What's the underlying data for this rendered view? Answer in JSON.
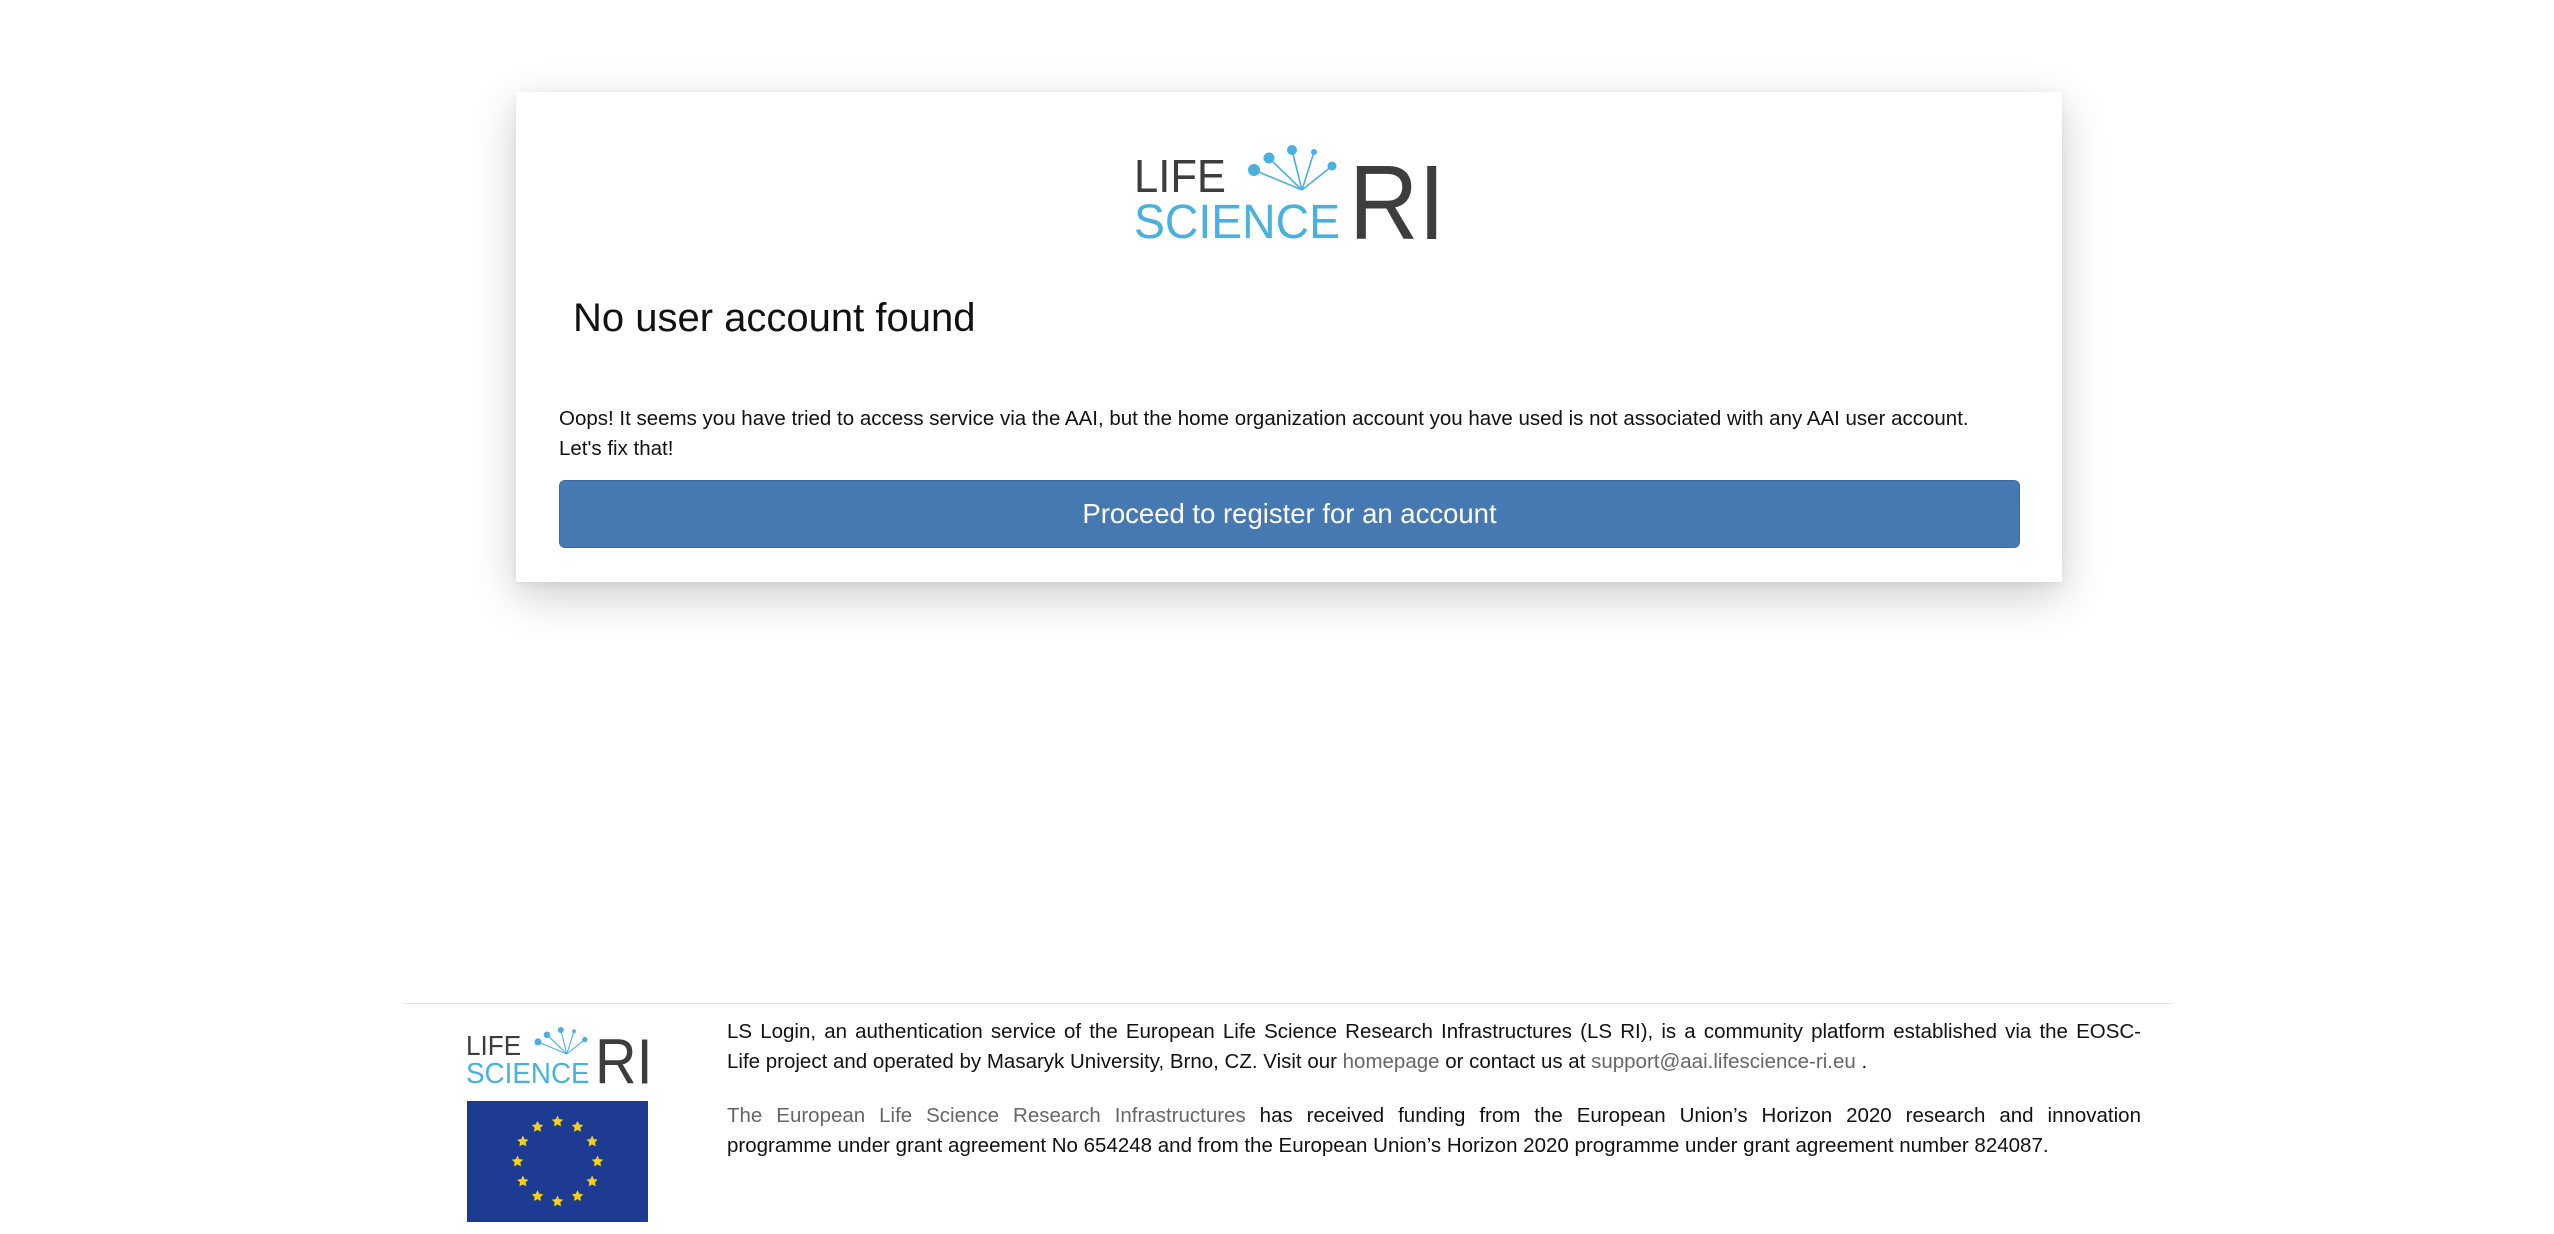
{
  "brand": {
    "logo_word_1": "LIFE",
    "logo_word_2": "SCIENCE",
    "logo_word_3": "RI",
    "dark_color": "#3d3d3d",
    "accent_color": "#4ab0e0"
  },
  "card": {
    "title": "No user account found",
    "message_line_1": "Oops! It seems you have tried to access service via the AAI, but the home organization account you have used is not associated with any AAI user account.",
    "message_line_2": "Let's fix that!",
    "register_button_label": "Proceed to register for an account",
    "button_color": "#4679b2"
  },
  "footer": {
    "para1_line1": "LS Login, an authentication service of the European Life Science Research Infrastructures (LS RI), is a community platform established via the EOSC-",
    "para1_line2_before": "Life project and operated by Masaryk University, Brno, CZ. Visit our ",
    "homepage_link": "homepage",
    "para1_line2_middle": " or contact us at ",
    "support_email": "support@aai.lifescience-ri.eu",
    "para1_line2_after": " .",
    "ri_link": "The European Life Science Research Infrastructures",
    "para2_line1_rest": " has received funding from the European Union’s Horizon 2020 research and innovation",
    "para2_line2": "programme under grant agreement No 654248 and from the European Union’s Horizon 2020 programme under grant agreement number 824087.",
    "eu_flag_color": "#1d3b93",
    "eu_star_color": "#f5cf1d"
  }
}
